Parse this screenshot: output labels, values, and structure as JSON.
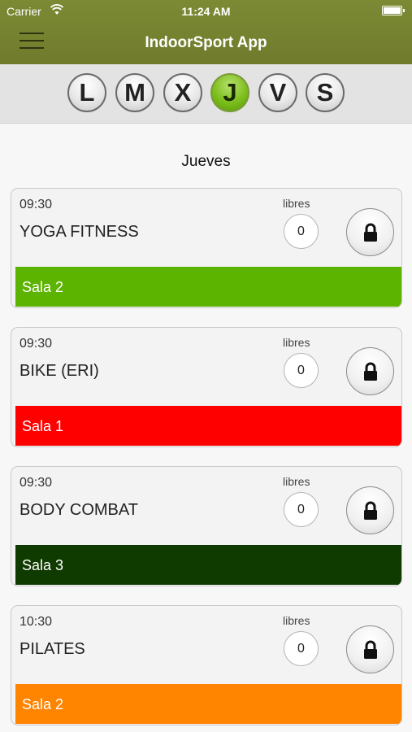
{
  "status_bar": {
    "carrier": "Carrier",
    "time": "11:24 AM"
  },
  "header": {
    "title": "IndoorSport App",
    "menu_icon": "hamburger-menu-icon"
  },
  "days": [
    {
      "label": "L",
      "active": false
    },
    {
      "label": "M",
      "active": false
    },
    {
      "label": "X",
      "active": false
    },
    {
      "label": "J",
      "active": true
    },
    {
      "label": "V",
      "active": false
    },
    {
      "label": "S",
      "active": false
    }
  ],
  "day_heading": "Jueves",
  "classes": [
    {
      "time": "09:30",
      "name": "YOGA FITNESS",
      "libres_label": "libres",
      "spots": "0",
      "room": "Sala 2",
      "room_color": "#5cb300"
    },
    {
      "time": "09:30",
      "name": "BIKE (ERI)",
      "libres_label": "libres",
      "spots": "0",
      "room": "Sala 1",
      "room_color": "#ff0000"
    },
    {
      "time": "09:30",
      "name": "BODY COMBAT",
      "libres_label": "libres",
      "spots": "0",
      "room": "Sala 3",
      "room_color": "#0f3a00"
    },
    {
      "time": "10:30",
      "name": "PILATES",
      "libres_label": "libres",
      "spots": "0",
      "room": "Sala 2",
      "room_color": "#ff8400"
    }
  ],
  "colors": {
    "header": "#76832f",
    "active_day": "#7cbf1c"
  }
}
